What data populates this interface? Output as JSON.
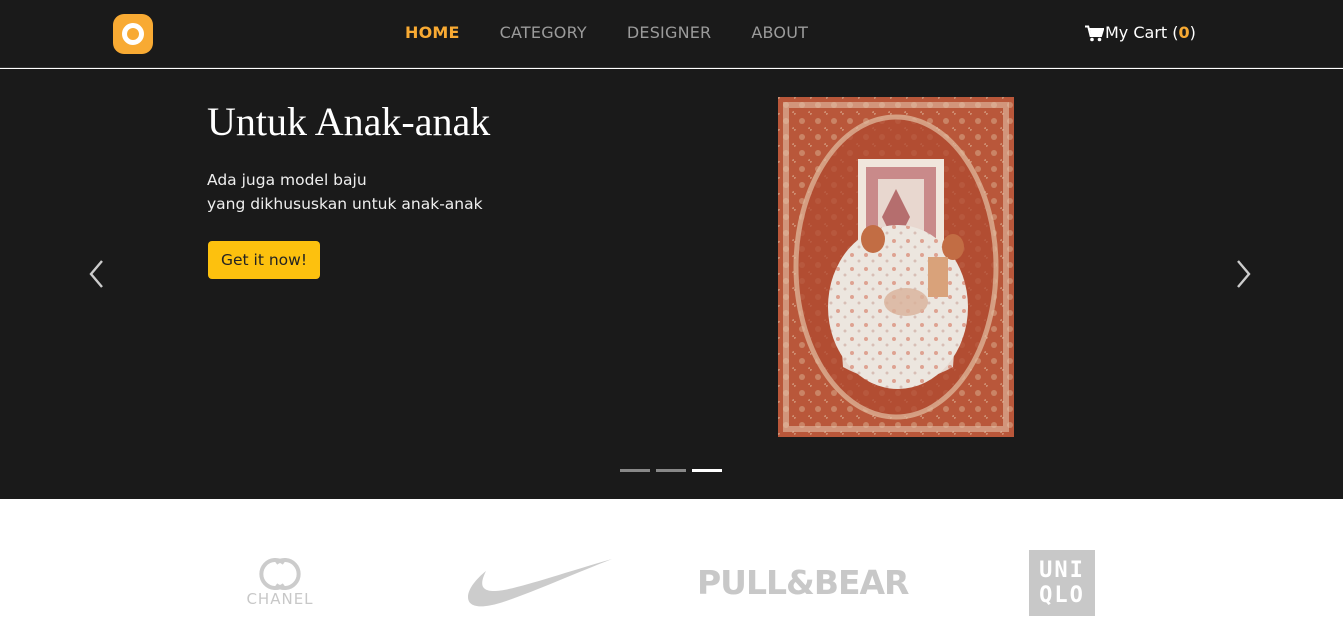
{
  "header": {
    "logo_icon": "circle-logo-icon",
    "nav": [
      {
        "label": "HOME",
        "active": true
      },
      {
        "label": "CATEGORY",
        "active": false
      },
      {
        "label": "DESIGNER",
        "active": false
      },
      {
        "label": "ABOUT",
        "active": false
      }
    ],
    "cart": {
      "icon": "cart-icon",
      "label": "My Cart (",
      "count": "0",
      "close": ")"
    }
  },
  "carousel": {
    "title": "Untuk Anak-anak",
    "description_line1": "Ada juga model baju",
    "description_line2": "yang dikhususkan untuk anak-anak",
    "cta_label": "Get it now!",
    "prev_icon": "chevron-left-icon",
    "next_icon": "chevron-right-icon",
    "slide_count": 3,
    "active_slide": 3
  },
  "brands": {
    "chanel_label": "CHANEL",
    "pullbear_label": "PULL&BEAR",
    "uniqlo_line1": "UNI",
    "uniqlo_line2": "QLO",
    "nike_icon": "nike-swoosh-icon"
  },
  "colors": {
    "accent": "#f8aa33",
    "cta": "#fdc10e",
    "dark_bg": "#1a1a1a",
    "brand_gray": "#cccccc"
  }
}
